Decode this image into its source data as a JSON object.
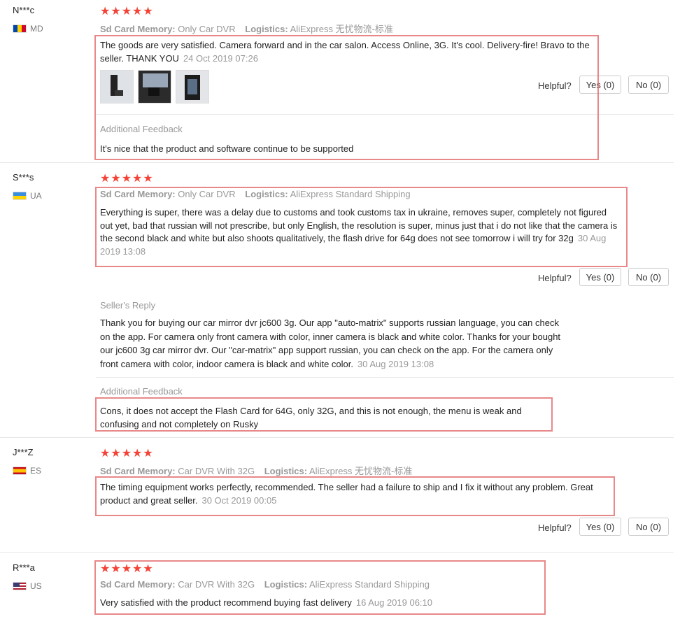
{
  "stars": "★★★★★",
  "meta_labels": {
    "sku": "Sd Card Memory:",
    "logistics": "Logistics:"
  },
  "helpful_label": "Helpful?",
  "additional_feedback_label": "Additional Feedback",
  "seller_reply_label": "Seller's Reply",
  "reviews": [
    {
      "user": "N***c",
      "country": "MD",
      "sku": "Only Car DVR",
      "logistics": "AliExpress 无忧物流-标准",
      "text": "The goods are very satisfied. Camera forward and in the car salon. Access Online, 3G. It's cool. Delivery-fire! Bravo to the seller. THANK YOU",
      "date": "24 Oct 2019 07:26",
      "yes": "Yes (0)",
      "no": "No (0)",
      "additional": "It's nice that the product and software continue to be supported"
    },
    {
      "user": "S***s",
      "country": "UA",
      "sku": "Only Car DVR",
      "logistics": "AliExpress Standard Shipping",
      "text": "Everything is super, there was a delay due to customs and took customs tax in ukraine, removes super, completely not figured out yet, bad that russian will not prescribe, but only English, the resolution is super, minus just that i do not like that the camera is the second black and white but also shoots qualitatively, the flash drive for 64g does not see tomorrow i will try for 32g",
      "date": "30 Aug 2019 13:08",
      "yes": "Yes (0)",
      "no": "No (0)",
      "reply": "Thank you for buying our car mirror dvr jc600 3g. Our app \"auto-matrix\" supports russian language, you can check on the app. For camera only front camera with color, inner camera is black and white color. Thanks for your bought our jc600 3g car mirror dvr. Our \"car-matrix\" app support russian, you can check on the app. For the camera only front camera with color, indoor camera is black and white color.",
      "reply_date": "30 Aug 2019 13:08",
      "additional": "Cons, it does not accept the Flash Card for 64G, only 32G, and this is not enough, the menu is weak and confusing and not completely on Rusky"
    },
    {
      "user": "J***Z",
      "country": "ES",
      "sku": "Car DVR With 32G",
      "logistics": "AliExpress 无忧物流-标准",
      "text": "The timing equipment works perfectly, recommended. The seller had a failure to ship and I fix it without any problem. Great product and great seller.",
      "date": "30 Oct 2019 00:05",
      "yes": "Yes (0)",
      "no": "No (0)"
    },
    {
      "user": "R***a",
      "country": "US",
      "sku": "Car DVR With 32G",
      "logistics": "AliExpress Standard Shipping",
      "text": "Very satisfied with the product recommend buying fast delivery",
      "date": "16 Aug 2019 06:10"
    }
  ]
}
